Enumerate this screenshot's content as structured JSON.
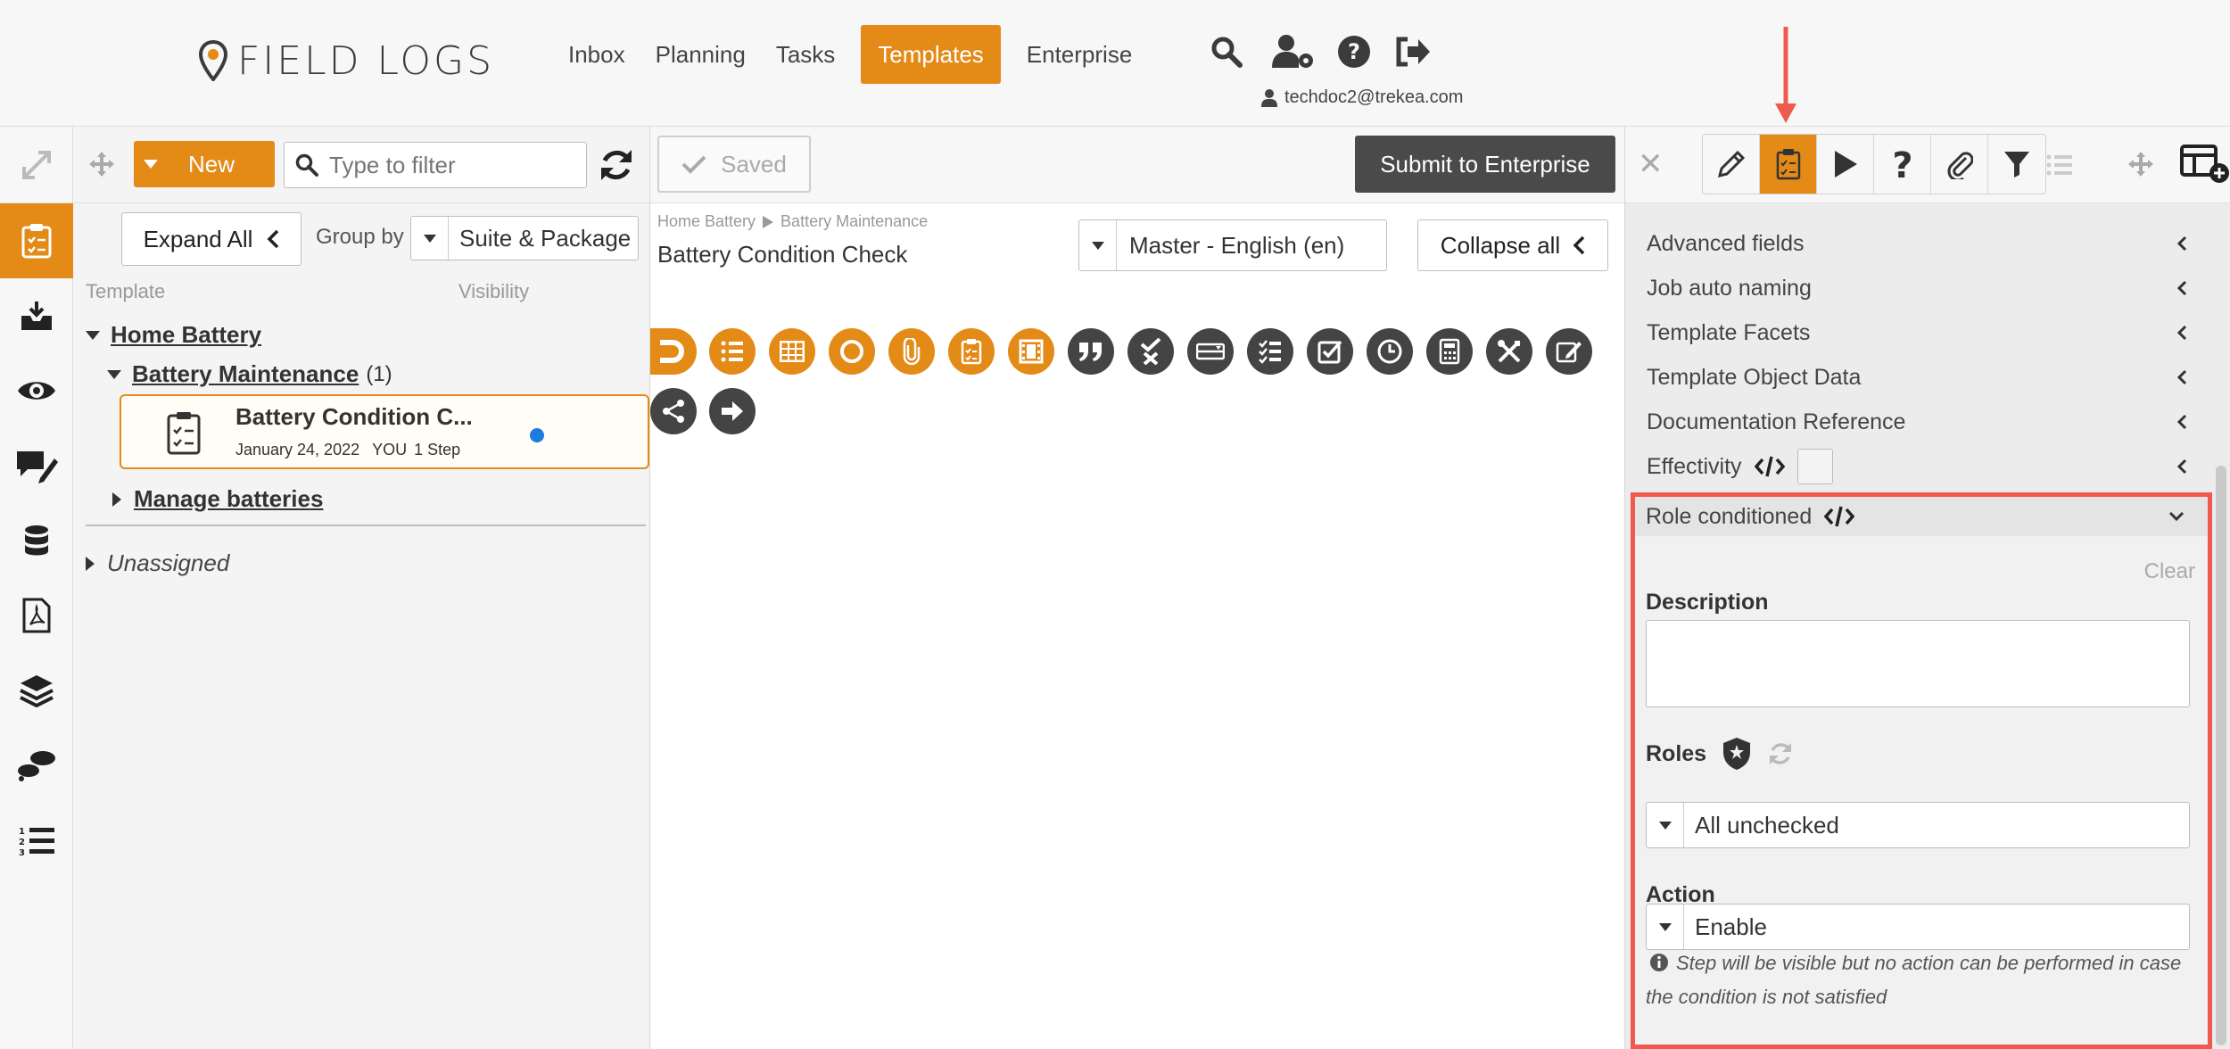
{
  "header": {
    "brand": "FIELD LOGS",
    "nav": [
      "Inbox",
      "Planning",
      "Tasks",
      "Templates",
      "Enterprise"
    ],
    "active_nav": "Templates",
    "user_email": "techdoc2@trekea.com",
    "icons": [
      "search-icon",
      "user-settings-icon",
      "help-icon",
      "logout-icon"
    ]
  },
  "colors": {
    "accent": "#e38a17",
    "dark": "#444444",
    "highlight": "#ee5a4f",
    "unsaved_dot": "#1e7be0"
  },
  "list_panel": {
    "new_label": "New",
    "filter_placeholder": "Type to filter",
    "expand_all_label": "Expand All",
    "group_by_label": "Group by",
    "group_by_value": "Suite & Package",
    "col_template": "Template",
    "col_visibility": "Visibility",
    "tree": {
      "root": "Home Battery",
      "package": "Battery Maintenance",
      "package_count": "(1)",
      "template_title": "Battery Condition C...",
      "template_date": "January 24, 2022",
      "template_owner": "YOU",
      "template_steps": "1 Step",
      "sibling": "Manage batteries",
      "unassigned": "Unassigned"
    }
  },
  "editor": {
    "saved_label": "Saved",
    "submit_label": "Submit to Enterprise",
    "breadcrumb": [
      "Home Battery",
      "Battery Maintenance"
    ],
    "title": "Battery Condition Check",
    "language": "Master - English (en)",
    "collapse_label": "Collapse all"
  },
  "properties": {
    "sections": [
      "Advanced fields",
      "Job auto naming",
      "Template Facets",
      "Template Object Data",
      "Documentation Reference",
      "Effectivity"
    ],
    "role_section": "Role conditioned",
    "clear_label": "Clear",
    "description_label": "Description",
    "description_value": "",
    "roles_label": "Roles",
    "roles_value": "All unchecked",
    "action_label": "Action",
    "action_value": "Enable",
    "help_text": "Step will be visible but no action can be performed in case the condition is not satisfied"
  }
}
